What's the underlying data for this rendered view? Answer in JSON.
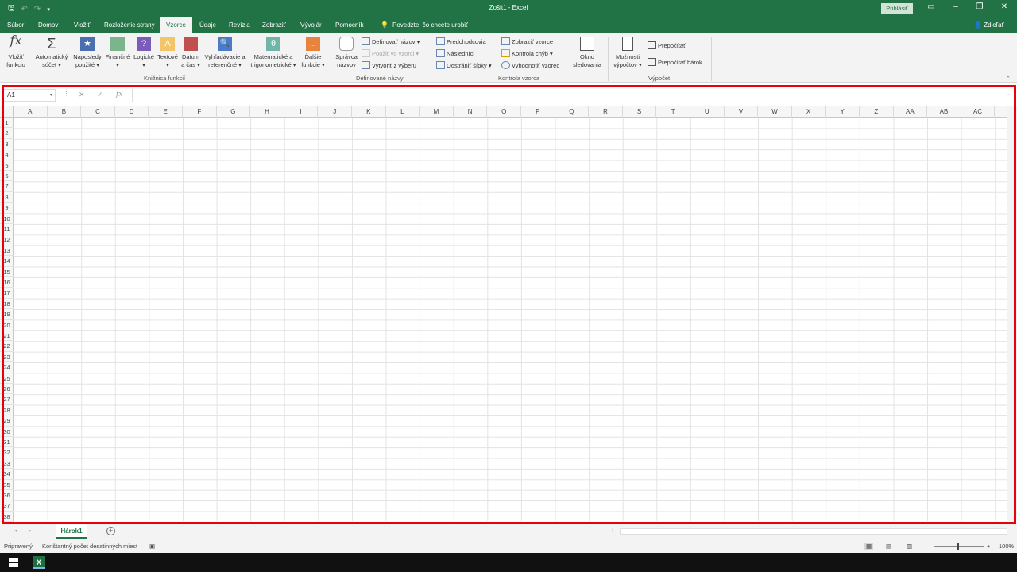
{
  "title": "Zošit1 - Excel",
  "signin_label": "Prihlásiť",
  "share_label": "Zdieľať",
  "tabs": [
    "Súbor",
    "Domov",
    "Vložiť",
    "Rozloženie strany",
    "Vzorce",
    "Údaje",
    "Revízia",
    "Zobraziť",
    "Vývojár",
    "Pomocník"
  ],
  "active_tab": "Vzorce",
  "tell_me": "Povedzte, čo chcete urobiť",
  "ribbon": {
    "function_library": {
      "label": "Knižnica funkcií",
      "insert_function": [
        "Vložiť",
        "funkciu"
      ],
      "autosum": [
        "Automatický",
        "súčet"
      ],
      "recent": [
        "Naposledy",
        "použité"
      ],
      "financial": "Finančné",
      "logical": "Logické",
      "text": "Textové",
      "datetime": [
        "Dátum",
        "a čas"
      ],
      "lookup": [
        "Vyhľadávacie a",
        "referenčné"
      ],
      "math": [
        "Matematické a",
        "trigonometrické"
      ],
      "more": [
        "Ďalšie",
        "funkcie"
      ]
    },
    "defined_names": {
      "label": "Definované názvy",
      "name_manager": [
        "Správca",
        "názvov"
      ],
      "define_name": "Definovať názov",
      "use_in_formula": "Použiť vo vzorci",
      "create_from_selection": "Vytvoriť z výberu"
    },
    "formula_auditing": {
      "label": "Kontrola vzorca",
      "trace_precedents": "Predchodcovia",
      "trace_dependents": "Následníci",
      "remove_arrows": "Odstrániť šípky",
      "show_formulas": "Zobraziť vzorce",
      "error_checking": "Kontrola chýb",
      "evaluate_formula": "Vyhodnotiť vzorec",
      "watch_window": [
        "Okno",
        "sledovania"
      ]
    },
    "calculation": {
      "label": "Výpočet",
      "options": [
        "Možnosti",
        "výpočtov"
      ],
      "calc_now": "Prepočítať",
      "calc_sheet": "Prepočítať hárok"
    }
  },
  "formula_bar": {
    "name_box": "A1",
    "cancel": "✕",
    "enter": "✓",
    "fx": "fx",
    "content": ""
  },
  "columns": [
    "A",
    "B",
    "C",
    "D",
    "E",
    "F",
    "G",
    "H",
    "I",
    "J",
    "K",
    "L",
    "M",
    "N",
    "O",
    "P",
    "Q",
    "R",
    "S",
    "T",
    "U",
    "V",
    "W",
    "X",
    "Y",
    "Z",
    "AA",
    "AB",
    "AC"
  ],
  "rows": [
    "1",
    "2",
    "3",
    "4",
    "5",
    "6",
    "7",
    "8",
    "9",
    "10",
    "11",
    "12",
    "13",
    "14",
    "15",
    "16",
    "17",
    "18",
    "19",
    "20",
    "21",
    "22",
    "23",
    "24",
    "25",
    "26",
    "27",
    "28",
    "29",
    "30",
    "31",
    "32",
    "33",
    "34",
    "35",
    "36",
    "37",
    "38"
  ],
  "sheet_tab": "Hárok1",
  "status": {
    "ready": "Pripravený",
    "fixed_decimals": "Konštantný počet desatinných miest",
    "zoom": "100%"
  },
  "colors": {
    "brand": "#217346",
    "highlight": "#e8000b"
  }
}
